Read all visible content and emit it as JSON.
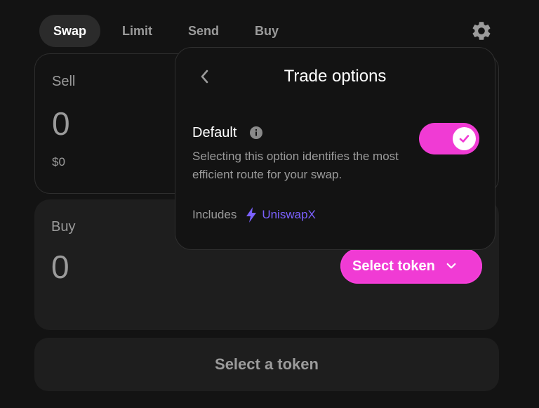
{
  "tabs": [
    {
      "label": "Swap",
      "active": true
    },
    {
      "label": "Limit",
      "active": false
    },
    {
      "label": "Send",
      "active": false
    },
    {
      "label": "Buy",
      "active": false
    }
  ],
  "sell": {
    "label": "Sell",
    "amount": "0",
    "usd": "$0"
  },
  "buy": {
    "label": "Buy",
    "amount": "0",
    "select_token_label": "Select token"
  },
  "cta_label": "Select a token",
  "trade_options": {
    "title": "Trade options",
    "option_title": "Default",
    "description": "Selecting this option identifies the most efficient route for your swap.",
    "includes_label": "Includes",
    "includes_value": "UniswapX",
    "toggle_on": true
  },
  "colors": {
    "accent_pink": "#f03bd4",
    "uniswapx_purple": "#7b61ff",
    "background": "#131313"
  },
  "icons": [
    "gear-icon",
    "back-chevron-icon",
    "info-icon",
    "lightning-icon",
    "check-icon",
    "chevron-down-icon"
  ]
}
